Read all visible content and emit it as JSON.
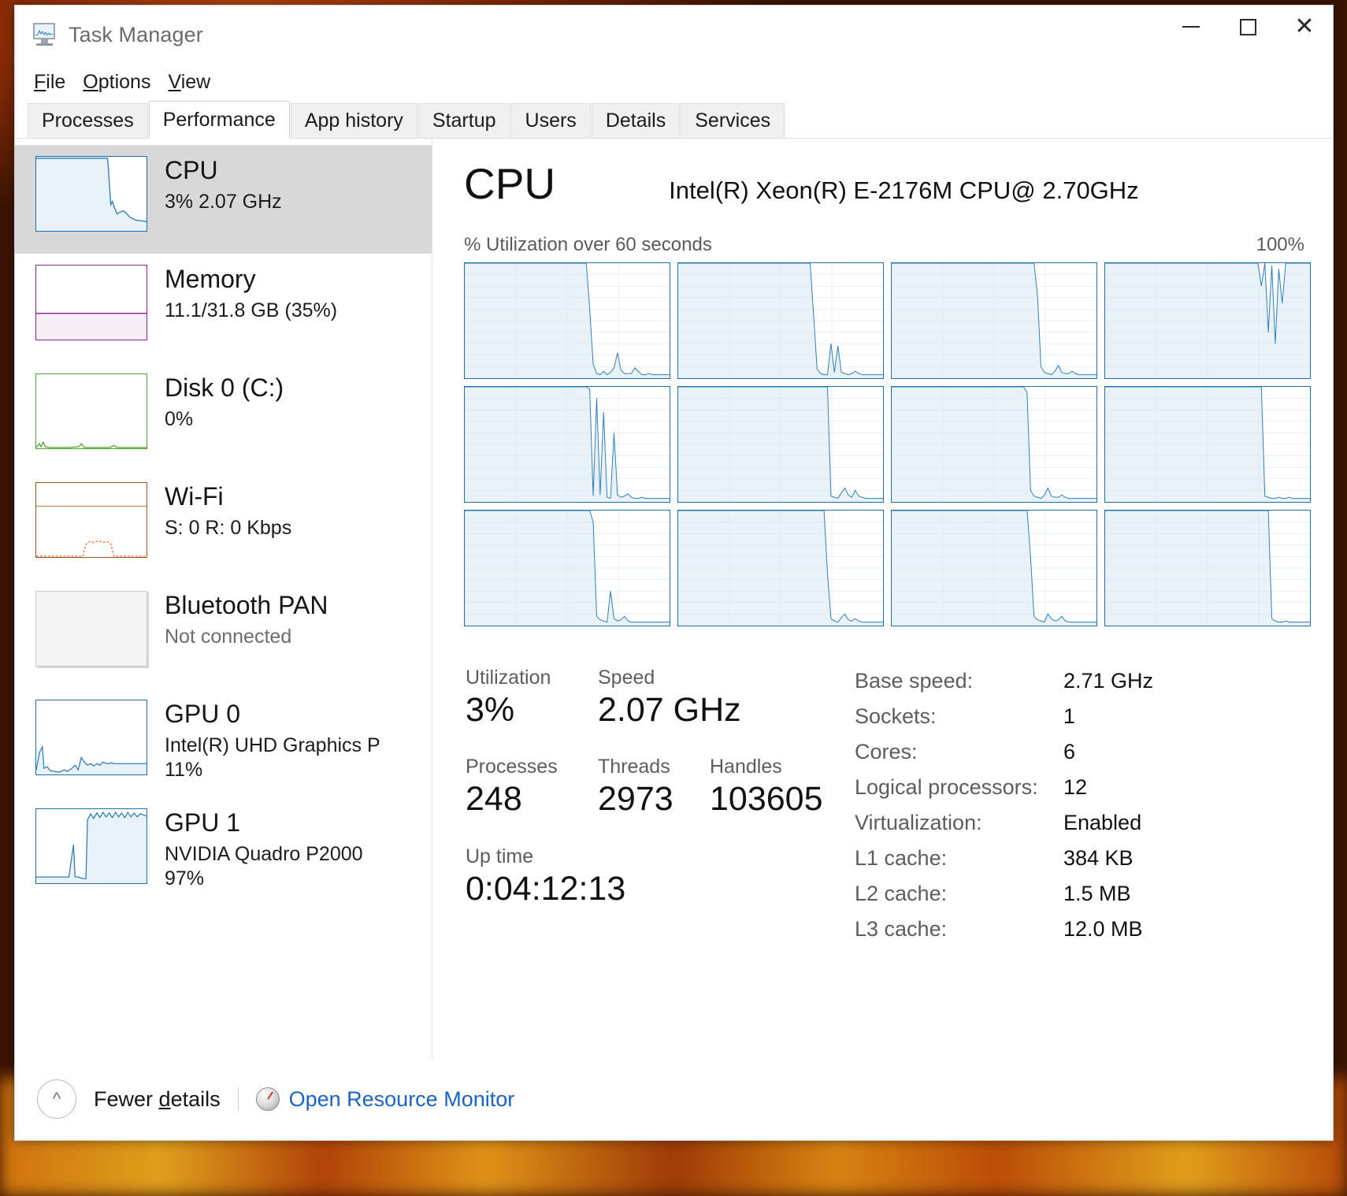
{
  "window": {
    "title": "Task Manager",
    "icon": "task-manager-icon",
    "controls": {
      "minimize": "Minimize",
      "maximize": "Maximize",
      "close": "Close"
    }
  },
  "menu": [
    {
      "label": "File",
      "accel": "F"
    },
    {
      "label": "Options",
      "accel": "O"
    },
    {
      "label": "View",
      "accel": "V"
    }
  ],
  "tabs": [
    {
      "label": "Processes",
      "active": false
    },
    {
      "label": "Performance",
      "active": true
    },
    {
      "label": "App history",
      "active": false
    },
    {
      "label": "Startup",
      "active": false
    },
    {
      "label": "Users",
      "active": false
    },
    {
      "label": "Details",
      "active": false
    },
    {
      "label": "Services",
      "active": false
    }
  ],
  "sidebar": {
    "items": [
      {
        "name": "CPU",
        "line1": "3%  2.07 GHz",
        "line2": "",
        "selected": true,
        "color": "#1a6fa8",
        "muted": false
      },
      {
        "name": "Memory",
        "line1": "11.1/31.8 GB (35%)",
        "line2": "",
        "selected": false,
        "color": "#8a218a",
        "muted": false
      },
      {
        "name": "Disk 0 (C:)",
        "line1": "0%",
        "line2": "",
        "selected": false,
        "color": "#4aa32a",
        "muted": false
      },
      {
        "name": "Wi-Fi",
        "line1": "S: 0 R: 0 Kbps",
        "line2": "",
        "selected": false,
        "color": "#a8521a",
        "muted": false
      },
      {
        "name": "Bluetooth PAN",
        "line1": "Not connected",
        "line2": "",
        "selected": false,
        "color": "#bdbdbd",
        "muted": true
      },
      {
        "name": "GPU 0",
        "line1": "Intel(R) UHD Graphics P",
        "line2": "11%",
        "selected": false,
        "color": "#1a6fa8",
        "muted": false
      },
      {
        "name": "GPU 1",
        "line1": "NVIDIA Quadro P2000",
        "line2": "97%",
        "selected": false,
        "color": "#1a6fa8",
        "muted": false
      }
    ]
  },
  "main": {
    "title": "CPU",
    "model": "Intel(R) Xeon(R) E-2176M CPU@ 2.70GHz",
    "graph_caption_left": "% Utilization over 60 seconds",
    "graph_caption_right": "100%",
    "stats": {
      "utilization_label": "Utilization",
      "utilization_value": "3%",
      "speed_label": "Speed",
      "speed_value": "2.07 GHz",
      "processes_label": "Processes",
      "processes_value": "248",
      "threads_label": "Threads",
      "threads_value": "2973",
      "handles_label": "Handles",
      "handles_value": "103605",
      "uptime_label": "Up time",
      "uptime_value": "0:04:12:13"
    },
    "specs": [
      {
        "key": "Base speed:",
        "value": "2.71 GHz"
      },
      {
        "key": "Sockets:",
        "value": "1"
      },
      {
        "key": "Cores:",
        "value": "6"
      },
      {
        "key": "Logical processors:",
        "value": "12"
      },
      {
        "key": "Virtualization:",
        "value": "Enabled"
      },
      {
        "key": "L1 cache:",
        "value": "384 KB"
      },
      {
        "key": "L2 cache:",
        "value": "1.5 MB"
      },
      {
        "key": "L3 cache:",
        "value": "12.0 MB"
      }
    ]
  },
  "footer": {
    "chevron_icon": "chevron-up-icon",
    "fewer_details": "Fewer details",
    "resource_monitor_icon": "resource-monitor-icon",
    "resource_monitor_link": "Open Resource Monitor"
  },
  "colors": {
    "cpu_line": "#1a6fa8",
    "cpu_fill": "#eaf2f9",
    "memory": "#8a218a",
    "disk": "#4aa32a",
    "wifi": "#a8521a",
    "link": "#1a62c4",
    "selection": "#d8d8d8"
  },
  "chart_data": {
    "type": "line",
    "title": "% Utilization over 60 seconds",
    "ylabel": "% Utilization",
    "xlabel": "60 seconds",
    "ylim": [
      0,
      100
    ],
    "xlim": [
      0,
      60
    ],
    "grid": true,
    "logical_processors": 12,
    "series": [
      {
        "name": "CPU 0",
        "values": [
          100,
          100,
          100,
          100,
          100,
          100,
          100,
          100,
          100,
          100,
          100,
          100,
          100,
          100,
          100,
          100,
          100,
          100,
          100,
          100,
          100,
          100,
          100,
          100,
          100,
          100,
          100,
          100,
          100,
          100,
          100,
          100,
          100,
          100,
          100,
          100,
          60,
          12,
          4,
          3,
          6,
          3,
          5,
          9,
          22,
          7,
          4,
          4,
          4,
          9,
          6,
          3,
          3,
          4,
          3,
          3,
          3,
          3,
          3,
          3
        ]
      },
      {
        "name": "CPU 1",
        "values": [
          100,
          100,
          100,
          100,
          100,
          100,
          100,
          100,
          100,
          100,
          100,
          100,
          100,
          100,
          100,
          100,
          100,
          100,
          100,
          100,
          100,
          100,
          100,
          100,
          100,
          100,
          100,
          100,
          100,
          100,
          100,
          100,
          100,
          100,
          100,
          100,
          100,
          100,
          100,
          55,
          8,
          4,
          3,
          3,
          30,
          5,
          28,
          5,
          4,
          3,
          4,
          6,
          4,
          3,
          3,
          3,
          3,
          3,
          3,
          3
        ]
      },
      {
        "name": "CPU 2",
        "values": [
          100,
          100,
          100,
          100,
          100,
          100,
          100,
          100,
          100,
          100,
          100,
          100,
          100,
          100,
          100,
          100,
          100,
          100,
          100,
          100,
          100,
          100,
          100,
          100,
          100,
          100,
          100,
          100,
          100,
          100,
          100,
          100,
          100,
          100,
          100,
          100,
          100,
          100,
          100,
          100,
          100,
          100,
          72,
          10,
          5,
          4,
          3,
          6,
          11,
          5,
          4,
          4,
          6,
          4,
          3,
          3,
          3,
          3,
          3,
          3
        ]
      },
      {
        "name": "CPU 3",
        "values": [
          100,
          100,
          100,
          100,
          100,
          100,
          100,
          100,
          100,
          100,
          100,
          100,
          100,
          100,
          100,
          100,
          100,
          100,
          100,
          100,
          100,
          100,
          100,
          100,
          100,
          100,
          100,
          100,
          100,
          100,
          100,
          100,
          100,
          100,
          100,
          100,
          100,
          100,
          100,
          100,
          100,
          100,
          100,
          100,
          100,
          80,
          100,
          40,
          98,
          30,
          95,
          65,
          100,
          100,
          100,
          100,
          100,
          100,
          100,
          100
        ]
      },
      {
        "name": "CPU 4",
        "values": [
          100,
          100,
          100,
          100,
          100,
          100,
          100,
          100,
          100,
          100,
          100,
          100,
          100,
          100,
          100,
          100,
          100,
          100,
          100,
          100,
          100,
          100,
          100,
          100,
          100,
          100,
          100,
          100,
          100,
          100,
          100,
          100,
          100,
          100,
          100,
          100,
          98,
          5,
          90,
          6,
          78,
          4,
          3,
          60,
          6,
          4,
          5,
          7,
          4,
          3,
          3,
          4,
          3,
          3,
          3,
          3,
          3,
          3,
          3,
          3
        ]
      },
      {
        "name": "CPU 5",
        "values": [
          100,
          100,
          100,
          100,
          100,
          100,
          100,
          100,
          100,
          100,
          100,
          100,
          100,
          100,
          100,
          100,
          100,
          100,
          100,
          100,
          100,
          100,
          100,
          100,
          100,
          100,
          100,
          100,
          100,
          100,
          100,
          100,
          100,
          100,
          100,
          100,
          100,
          100,
          100,
          100,
          100,
          100,
          100,
          100,
          5,
          4,
          3,
          8,
          12,
          6,
          4,
          10,
          5,
          4,
          3,
          3,
          3,
          3,
          3,
          3
        ]
      },
      {
        "name": "CPU 6",
        "values": [
          100,
          100,
          100,
          100,
          100,
          100,
          100,
          100,
          100,
          100,
          100,
          100,
          100,
          100,
          100,
          100,
          100,
          100,
          100,
          100,
          100,
          100,
          100,
          100,
          100,
          100,
          100,
          100,
          100,
          100,
          100,
          100,
          100,
          100,
          100,
          100,
          100,
          100,
          100,
          95,
          10,
          5,
          4,
          3,
          6,
          12,
          5,
          4,
          4,
          6,
          4,
          3,
          3,
          3,
          3,
          3,
          3,
          3,
          3,
          3
        ]
      },
      {
        "name": "CPU 7",
        "values": [
          100,
          100,
          100,
          100,
          100,
          100,
          100,
          100,
          100,
          100,
          100,
          100,
          100,
          100,
          100,
          100,
          100,
          100,
          100,
          100,
          100,
          100,
          100,
          100,
          100,
          100,
          100,
          100,
          100,
          100,
          100,
          100,
          100,
          100,
          100,
          100,
          100,
          100,
          100,
          100,
          100,
          100,
          100,
          100,
          100,
          100,
          5,
          4,
          3,
          3,
          4,
          3,
          3,
          4,
          3,
          3,
          3,
          3,
          3,
          3
        ]
      },
      {
        "name": "CPU 8",
        "values": [
          100,
          100,
          100,
          100,
          100,
          100,
          100,
          100,
          100,
          100,
          100,
          100,
          100,
          100,
          100,
          100,
          100,
          100,
          100,
          100,
          100,
          100,
          100,
          100,
          100,
          100,
          100,
          100,
          100,
          100,
          100,
          100,
          100,
          100,
          100,
          100,
          100,
          90,
          8,
          5,
          4,
          3,
          30,
          6,
          4,
          5,
          8,
          4,
          3,
          3,
          3,
          3,
          3,
          3,
          3,
          3,
          3,
          3,
          3,
          3
        ]
      },
      {
        "name": "CPU 9",
        "values": [
          100,
          100,
          100,
          100,
          100,
          100,
          100,
          100,
          100,
          100,
          100,
          100,
          100,
          100,
          100,
          100,
          100,
          100,
          100,
          100,
          100,
          100,
          100,
          100,
          100,
          100,
          100,
          100,
          100,
          100,
          100,
          100,
          100,
          100,
          100,
          100,
          100,
          100,
          100,
          100,
          100,
          100,
          100,
          45,
          6,
          4,
          3,
          7,
          10,
          5,
          4,
          6,
          4,
          3,
          3,
          3,
          3,
          3,
          3,
          3
        ]
      },
      {
        "name": "CPU 10",
        "values": [
          100,
          100,
          100,
          100,
          100,
          100,
          100,
          100,
          100,
          100,
          100,
          100,
          100,
          100,
          100,
          100,
          100,
          100,
          100,
          100,
          100,
          100,
          100,
          100,
          100,
          100,
          100,
          100,
          100,
          100,
          100,
          100,
          100,
          100,
          100,
          100,
          100,
          100,
          100,
          100,
          60,
          8,
          5,
          4,
          3,
          10,
          6,
          4,
          5,
          8,
          4,
          3,
          3,
          3,
          3,
          3,
          3,
          3,
          3,
          3
        ]
      },
      {
        "name": "CPU 11",
        "values": [
          100,
          100,
          100,
          100,
          100,
          100,
          100,
          100,
          100,
          100,
          100,
          100,
          100,
          100,
          100,
          100,
          100,
          100,
          100,
          100,
          100,
          100,
          100,
          100,
          100,
          100,
          100,
          100,
          100,
          100,
          100,
          100,
          100,
          100,
          100,
          100,
          100,
          100,
          100,
          100,
          100,
          100,
          100,
          100,
          100,
          100,
          100,
          100,
          6,
          4,
          3,
          3,
          4,
          3,
          3,
          3,
          3,
          3,
          3,
          3
        ]
      }
    ],
    "thumbnails": {
      "cpu": [
        100,
        100,
        100,
        100,
        100,
        100,
        100,
        100,
        100,
        100,
        100,
        100,
        100,
        100,
        100,
        100,
        100,
        100,
        100,
        100,
        100,
        100,
        100,
        100,
        100,
        100,
        100,
        100,
        100,
        100,
        100,
        100,
        100,
        100,
        100,
        100,
        100,
        100,
        100,
        60,
        10,
        5,
        4,
        6,
        5,
        14,
        10,
        6,
        4,
        3,
        3,
        3,
        3,
        3,
        3,
        3,
        3,
        3,
        3,
        3
      ],
      "memory_pct": 35,
      "disk": [
        2,
        5,
        1,
        0,
        0,
        1,
        0,
        0,
        0,
        0,
        0,
        0,
        0,
        0,
        0,
        0,
        0,
        0,
        0,
        0,
        0,
        0,
        0,
        3,
        0,
        0,
        0,
        0,
        0,
        0,
        1,
        0,
        0,
        0,
        0,
        0,
        0,
        0,
        0,
        0,
        0,
        0,
        0,
        0,
        0,
        0,
        0,
        0,
        0,
        0,
        0,
        0,
        0,
        0,
        0,
        0,
        0,
        0,
        0,
        0
      ],
      "wifi": [
        0,
        0,
        0,
        0,
        0,
        0,
        0,
        0,
        0,
        0,
        0,
        0,
        0,
        0,
        0,
        0,
        0,
        0,
        0,
        0,
        0,
        0,
        0,
        0,
        0,
        0,
        0,
        0,
        0,
        0,
        0,
        0,
        0,
        0,
        0,
        0,
        18,
        20,
        21,
        20,
        22,
        21,
        20,
        21,
        22,
        21,
        20,
        21,
        21,
        20,
        21,
        20,
        19,
        3,
        0,
        0,
        0,
        0,
        0,
        0
      ],
      "gpu0": [
        5,
        32,
        10,
        6,
        4,
        3,
        4,
        3,
        5,
        3,
        8,
        4,
        3,
        2,
        3,
        5,
        4,
        3,
        6,
        10,
        5,
        4,
        8,
        22,
        10,
        6,
        8,
        12,
        10,
        14,
        12,
        13,
        11,
        12,
        13,
        12,
        12,
        13,
        12,
        13,
        12,
        12,
        13,
        12,
        12,
        12,
        12,
        12,
        12,
        12,
        12,
        12,
        12,
        12,
        12,
        12,
        12,
        12,
        12,
        12
      ],
      "gpu1": [
        4,
        4,
        5,
        4,
        4,
        5,
        4,
        4,
        4,
        5,
        4,
        4,
        4,
        4,
        5,
        4,
        4,
        4,
        5,
        4,
        4,
        4,
        4,
        40,
        6,
        4,
        4,
        4,
        3,
        3,
        4,
        3,
        3,
        96,
        99,
        96,
        100,
        97,
        99,
        96,
        100,
        97,
        99,
        96,
        100,
        97,
        99,
        96,
        100,
        97,
        99,
        96,
        100,
        97,
        99,
        96,
        100,
        97,
        99,
        97
      ]
    }
  }
}
